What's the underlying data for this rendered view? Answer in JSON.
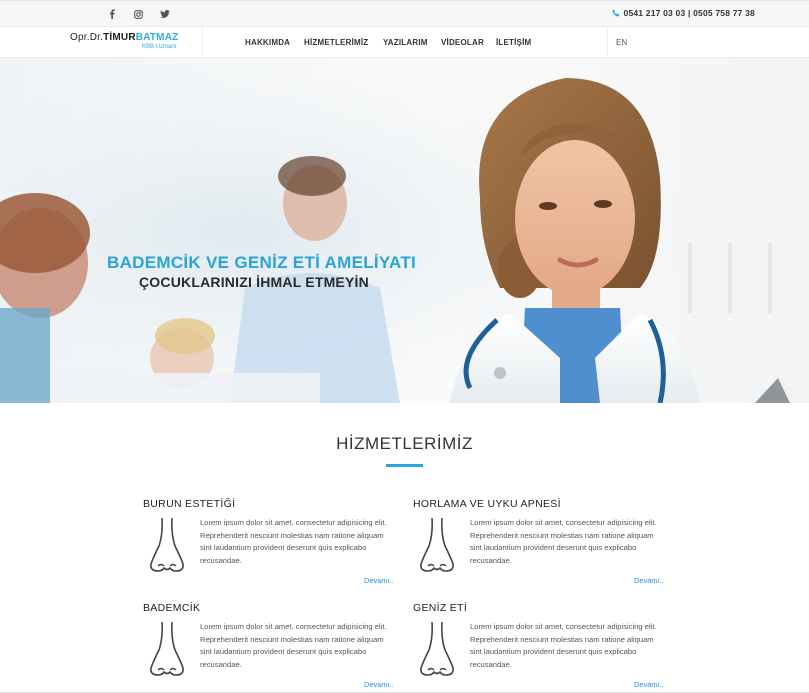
{
  "topbar": {
    "social": [
      {
        "name": "facebook",
        "glyph": "f"
      },
      {
        "name": "instagram",
        "glyph": "◎"
      },
      {
        "name": "twitter",
        "glyph": "🐦"
      }
    ],
    "phone": "0541 217 03 03 | 0505 758 77 38"
  },
  "logo": {
    "part1": "Opr.Dr.",
    "part2": "TİMUR",
    "part3": "BATMAZ",
    "subtitle": "KBB Uzmanı"
  },
  "nav": {
    "items": [
      "HAKKIMDA",
      "HİZMETLERİMİZ",
      "YAZILARIM",
      "VİDEOLAR",
      "İLETİŞİM"
    ],
    "lang": "EN"
  },
  "hero": {
    "title": "BADEMCİK VE GENİZ ETİ AMELİYATI",
    "subtitle": "ÇOCUKLARINIZI İHMAL ETMEYİN"
  },
  "services": {
    "title": "HİZMETLERİMİZ",
    "items": [
      {
        "title": "BURUN ESTETİĞİ",
        "text": "Lorem ipsum dolor sit amet, consectetur adipisicing elit. Reprehenderit nesciunt molestias nam ratione aliquam sint laudantium provident deserunt quis explicabo recusandae.",
        "more": "Devamı.."
      },
      {
        "title": "HORLAMA VE UYKU APNESİ",
        "text": "Lorem ipsum dolor sit amet, consectetur adipisicing elit. Reprehenderit nesciunt molestias nam ratione aliquam sint laudantium provident deserunt quis explicabo recusandae.",
        "more": "Devamı.."
      },
      {
        "title": "BADEMCİK",
        "text": "Lorem ipsum dolor sit amet, consectetur adipisicing elit. Reprehenderit nesciunt molestias nam ratione aliquam sint laudantium provident deserunt quis explicabo recusandae.",
        "more": "Devamı.."
      },
      {
        "title": "GENİZ ETİ",
        "text": "Lorem ipsum dolor sit amet, consectetur adipisicing elit. Reprehenderit nesciunt molestias nam ratione aliquam sint laudantium provident deserunt quis explicabo recusandae.",
        "more": "Devamı.."
      }
    ]
  },
  "colors": {
    "accent": "#29a8df",
    "link": "#2b8fd1"
  }
}
